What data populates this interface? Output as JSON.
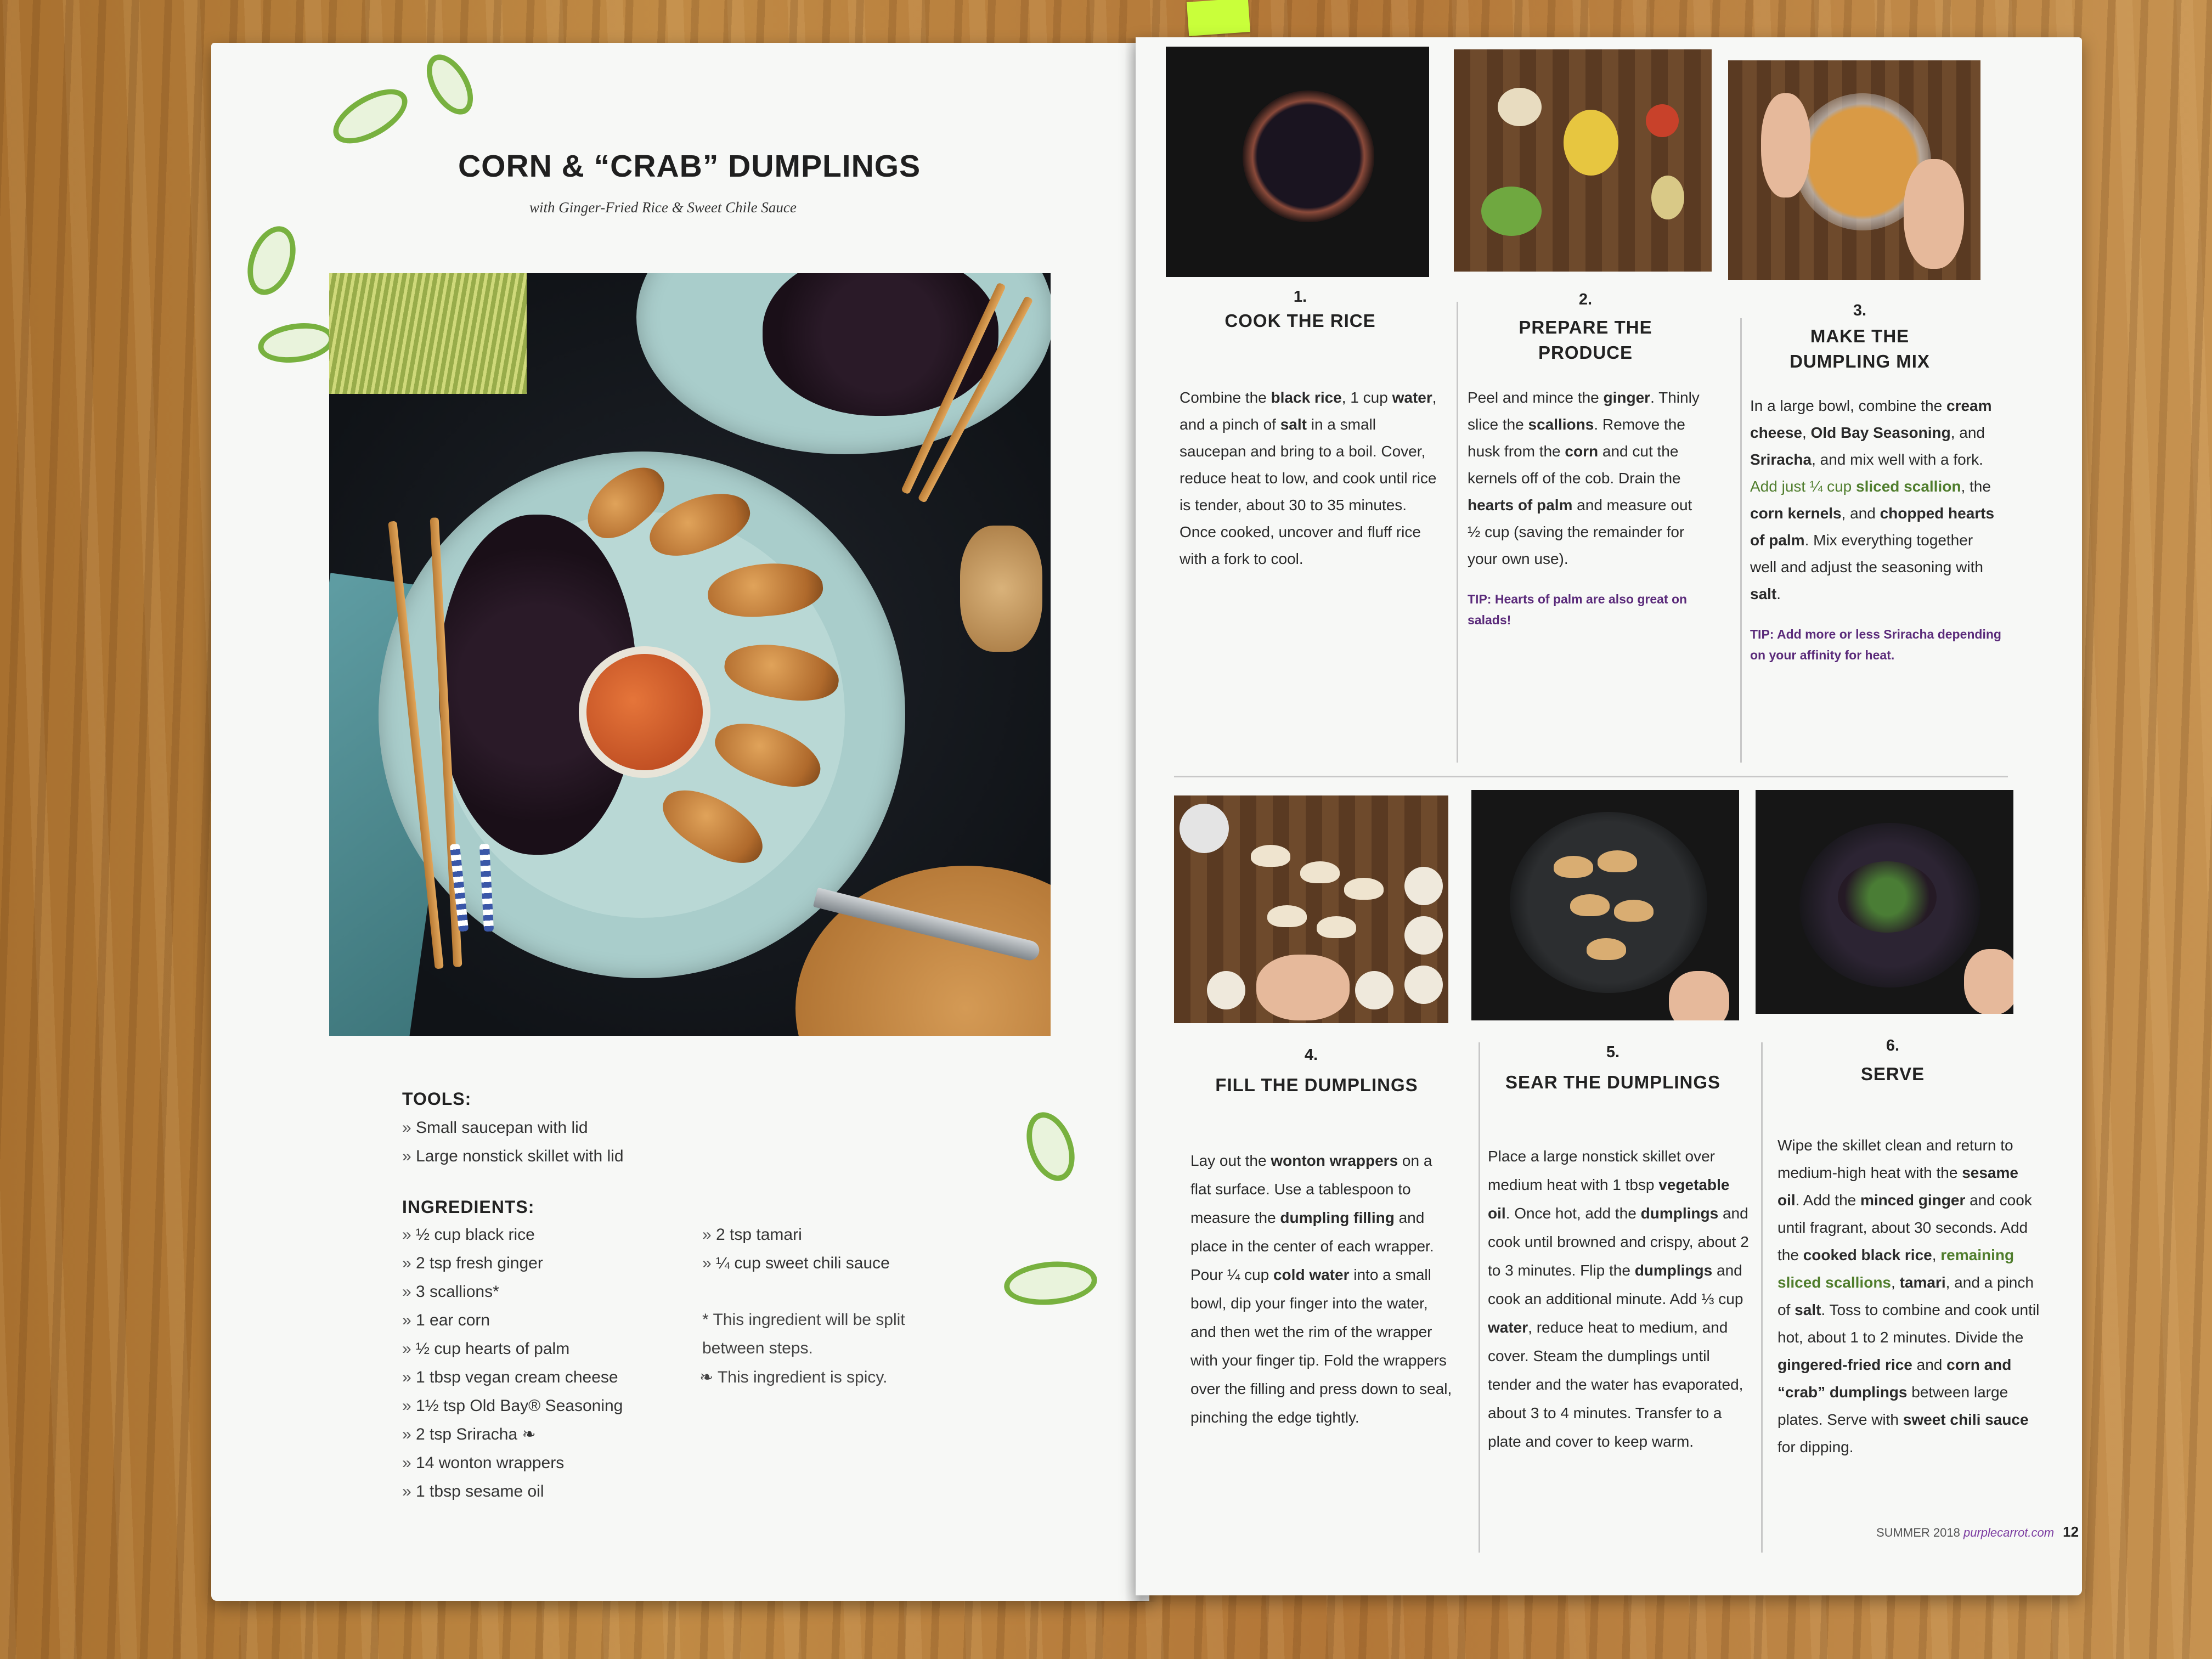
{
  "recipe": {
    "title": "CORN & “CRAB” DUMPLINGS",
    "subtitle": "with Ginger-Fried Rice & Sweet Chile Sauce"
  },
  "tools": {
    "heading": "TOOLS:",
    "items": [
      "Small saucepan with lid",
      "Large nonstick skillet with lid"
    ]
  },
  "ingredients": {
    "heading": "INGREDIENTS:",
    "col1": [
      "½ cup black rice",
      "2 tsp fresh ginger",
      "3 scallions*",
      "1 ear corn",
      "½ cup hearts of palm",
      "1 tbsp vegan cream cheese",
      "1½ tsp Old Bay® Seasoning",
      "2 tsp Sriracha ❧",
      "14 wonton wrappers",
      "1 tbsp sesame oil"
    ],
    "col2": [
      "2 tsp tamari",
      "¼ cup sweet chili sauce"
    ],
    "note_split": "*  This ingredient will be split between steps.",
    "note_spicy": "❧ This ingredient is spicy."
  },
  "steps": [
    {
      "num": "1.",
      "title": "COOK THE RICE"
    },
    {
      "num": "2.",
      "title": "PREPARE THE PRODUCE"
    },
    {
      "num": "3.",
      "title": "MAKE THE DUMPLING MIX"
    },
    {
      "num": "4.",
      "title": "FILL THE DUMPLINGS"
    },
    {
      "num": "5.",
      "title": "SEAR THE DUMPLINGS"
    },
    {
      "num": "6.",
      "title": "SERVE"
    }
  ],
  "step_text": {
    "s1_a": "Combine the ",
    "s1_b": "black rice",
    "s1_c": ", 1 cup ",
    "s1_d": "water",
    "s1_e": ", and a pinch of ",
    "s1_f": "salt",
    "s1_g": " in a small saucepan and bring to a boil. Cover, reduce heat to low, and cook until rice is tender, about 30 to 35 minutes. Once cooked, uncover and fluff rice with a fork to cool.",
    "s2_a": "Peel and mince the ",
    "s2_b": "ginger",
    "s2_c": ". Thinly slice the ",
    "s2_d": "scallions",
    "s2_e": ". Remove the husk from the ",
    "s2_f": "corn",
    "s2_g": " and cut the kernels off of the cob. Drain the ",
    "s2_h": "hearts of palm",
    "s2_i": " and measure out ½ cup (saving the remainder for your own use).",
    "s2_tip": "TIP: Hearts of palm are also great on salads!",
    "s3_a": "In a large bowl, combine the ",
    "s3_b": "cream cheese",
    "s3_c": ", ",
    "s3_d": "Old Bay Seasoning",
    "s3_e": ", and ",
    "s3_f": "Sriracha",
    "s3_g": ", and mix well with a fork. ",
    "s3_h": "Add just ¼ cup",
    "s3_i": " ",
    "s3_j": "sliced scallion",
    "s3_k": ", the ",
    "s3_l": "corn kernels",
    "s3_m": ", and ",
    "s3_n": "chopped hearts of palm",
    "s3_o": ". Mix everything together well and adjust the seasoning with ",
    "s3_p": "salt",
    "s3_q": ".",
    "s3_tip": "TIP: Add more or less Sriracha depending on your affinity for heat.",
    "s4_a": "Lay out the ",
    "s4_b": "wonton wrappers",
    "s4_c": " on a flat surface. Use a tablespoon to measure the ",
    "s4_d": "dumpling filling",
    "s4_e": " and place in the center of each wrapper. Pour ¼ cup ",
    "s4_f": "cold water",
    "s4_g": " into a small bowl, dip your finger into the water, and then wet the rim of the wrapper with your finger tip. Fold the wrappers over the filling and press down to seal, pinching the edge tightly.",
    "s5_a": "Place a large nonstick skillet over medium heat with 1 tbsp ",
    "s5_b": "vegetable oil",
    "s5_c": ". Once hot, add the ",
    "s5_d": "dumplings",
    "s5_e": " and cook until browned and crispy, about 2 to 3 minutes. Flip the ",
    "s5_f": "dumplings",
    "s5_g": " and cook an additional minute. Add ⅓ cup ",
    "s5_h": "water",
    "s5_i": ", reduce heat to medium, and cover. Steam the dumplings until tender and the water has evaporated, about 3 to 4 minutes. Transfer to a plate and cover to keep warm.",
    "s6_a": "Wipe the skillet clean and return to medium-high heat with the ",
    "s6_b": "sesame oil",
    "s6_c": ". Add the ",
    "s6_d": "minced ginger",
    "s6_e": " and cook until fragrant, about 30 seconds. Add the ",
    "s6_f": "cooked black rice",
    "s6_g": ", ",
    "s6_h": "remaining sliced scallions",
    "s6_i": ", ",
    "s6_j": "tamari",
    "s6_k": ", and a pinch of ",
    "s6_l": "salt",
    "s6_m": ". Toss to combine and cook until hot, about 1 to 2 minutes. Divide the ",
    "s6_n": "gingered-fried rice",
    "s6_o": " and ",
    "s6_p": "corn and “crab” dumplings",
    "s6_q": " between large plates. Serve with ",
    "s6_r": "sweet chili sauce",
    "s6_s": " for dipping."
  },
  "footer": {
    "season": "SUMMER 2018",
    "brand": "purplecarrot.com",
    "page": "12"
  },
  "colors": {
    "accent_green": "#4f7d2c",
    "tip_purple": "#5a2a7a",
    "page": "#f7f8f6"
  }
}
